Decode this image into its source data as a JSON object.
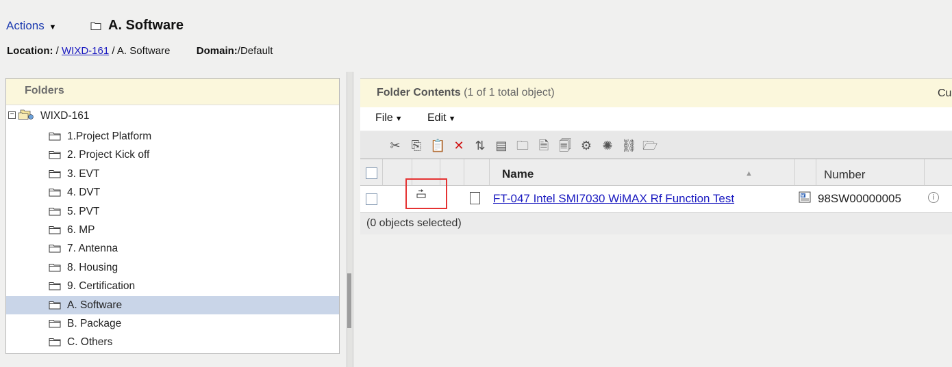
{
  "header": {
    "actions_label": "Actions",
    "actions_caret": "▼",
    "title": "A. Software",
    "location_label": "Location:",
    "location_link": "WIXD-161",
    "location_sep1": "/",
    "location_sep2": "/",
    "location_current": "A. Software",
    "domain_label": "Domain:",
    "domain_value": "/Default"
  },
  "folders": {
    "title": "Folders",
    "root": {
      "label": "WIXD-161",
      "toggle": "−"
    },
    "items": [
      {
        "label": "1.Project Platform"
      },
      {
        "label": "2. Project Kick off"
      },
      {
        "label": "3. EVT"
      },
      {
        "label": "4. DVT"
      },
      {
        "label": "5. PVT"
      },
      {
        "label": "6. MP"
      },
      {
        "label": "7. Antenna"
      },
      {
        "label": "8. Housing"
      },
      {
        "label": "9. Certification"
      },
      {
        "label": "A. Software",
        "selected": true
      },
      {
        "label": "B. Package"
      },
      {
        "label": "C. Others"
      }
    ]
  },
  "contents": {
    "title": "Folder Contents",
    "count": "(1 of 1 total object)",
    "cu": "Cu",
    "menus": {
      "file": "File",
      "edit": "Edit",
      "caret": "▼"
    },
    "toolbar": [
      {
        "icon": "cut-icon",
        "glyph": "✂"
      },
      {
        "icon": "copy-icon",
        "glyph": "⎘"
      },
      {
        "icon": "paste-icon",
        "glyph": "📋"
      },
      {
        "icon": "delete-icon",
        "glyph": "✕",
        "color": "#d01010"
      },
      {
        "icon": "move-icon",
        "glyph": "⇅"
      },
      {
        "icon": "rename-icon",
        "glyph": "▤"
      },
      {
        "icon": "new-folder-icon",
        "glyph": "🗀"
      },
      {
        "icon": "new-document-icon",
        "glyph": "🗎"
      },
      {
        "icon": "new-documents-icon",
        "glyph": "🗐"
      },
      {
        "icon": "new-part-icon",
        "glyph": "⚙"
      },
      {
        "icon": "new-parts-icon",
        "glyph": "✺"
      },
      {
        "icon": "link-icon",
        "glyph": "⛓"
      },
      {
        "icon": "folder-link-icon",
        "glyph": "🗁"
      }
    ],
    "table": {
      "columns": {
        "name": "Name",
        "sort": "▲",
        "number": "Number"
      },
      "rows": [
        {
          "name": "FT-047 Intel SMI7030 WiMAX Rf Function Test",
          "number": "98SW00000005",
          "info": "i"
        }
      ]
    },
    "selected_status": "(0 objects selected)"
  },
  "colors": {
    "header_bg": "#fbf7dc",
    "selected_row": "#c9d5e8",
    "link": "#1a1ac0",
    "highlight": "#e53232"
  }
}
